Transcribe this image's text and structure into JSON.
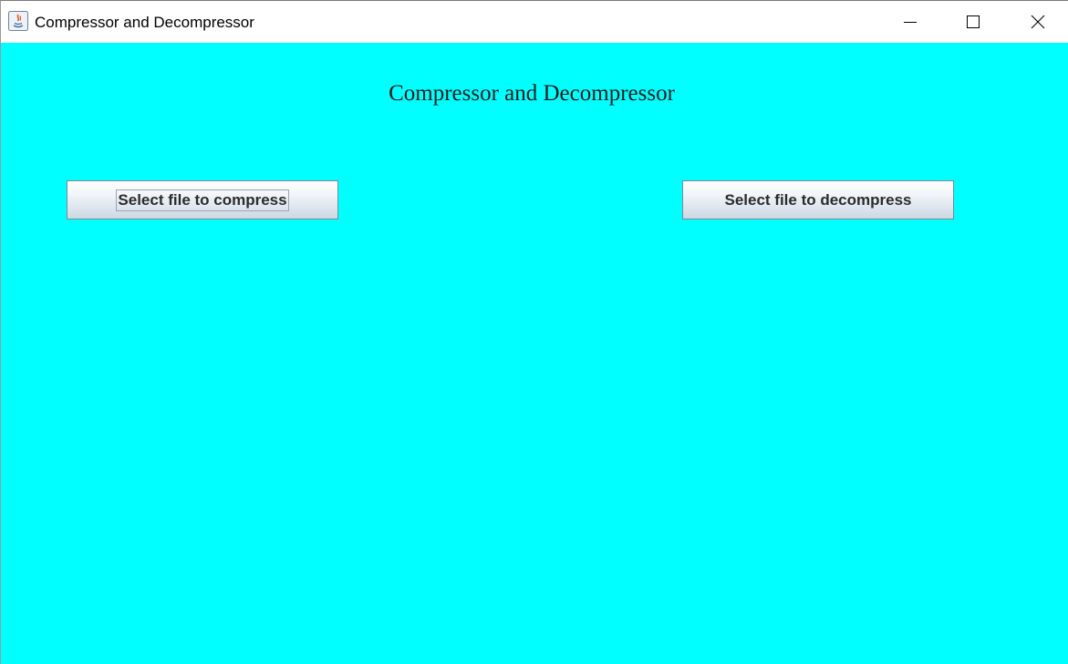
{
  "window": {
    "title": "Compressor and Decompressor",
    "icon": "java-app-icon",
    "controls": {
      "minimize": "minimize-icon",
      "maximize": "maximize-icon",
      "close": "close-icon"
    }
  },
  "main": {
    "background_color": "#00ffff",
    "heading": "Compressor and Decompressor",
    "buttons": {
      "compress_label": "Select file to compress",
      "decompress_label": "Select file to decompress"
    }
  }
}
